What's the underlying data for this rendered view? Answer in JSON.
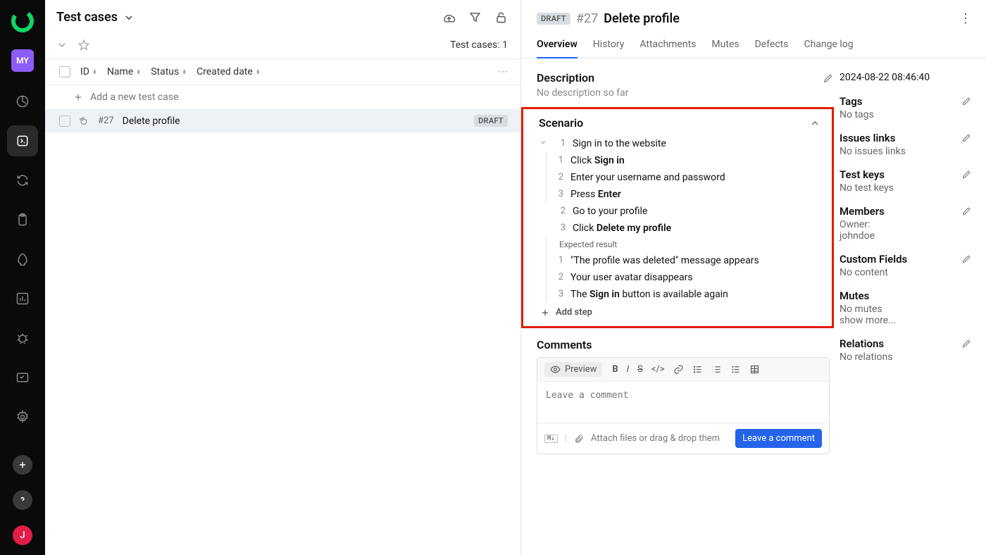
{
  "sidebar": {
    "project_badge": "MY",
    "user_initial": "J"
  },
  "left": {
    "title": "Test cases",
    "count_label": "Test cases: 1",
    "columns": {
      "id": "ID",
      "name": "Name",
      "status": "Status",
      "created": "Created date"
    },
    "add_row": "Add a new test case",
    "row": {
      "id": "#27",
      "name": "Delete profile",
      "badge": "DRAFT"
    }
  },
  "detail": {
    "badge": "DRAFT",
    "id": "#27",
    "title": "Delete profile",
    "tabs": {
      "overview": "Overview",
      "history": "History",
      "attachments": "Attachments",
      "mutes": "Mutes",
      "defects": "Defects",
      "changelog": "Change log"
    },
    "description_title": "Description",
    "description_value": "No description so far",
    "scenario_title": "Scenario",
    "steps": {
      "s1": {
        "num": "1",
        "text": "Sign in to the website",
        "sub": {
          "a": {
            "num": "1",
            "pre": "Click ",
            "bold": "Sign in"
          },
          "b": {
            "num": "2",
            "text": "Enter your username and password"
          },
          "c": {
            "num": "3",
            "pre": "Press ",
            "bold": "Enter"
          }
        }
      },
      "s2": {
        "num": "2",
        "text": "Go to your profile"
      },
      "s3": {
        "num": "3",
        "pre": "Click ",
        "bold": "Delete my profile",
        "expected_label": "Expected result",
        "expected": {
          "a": {
            "num": "1",
            "text": "\"The profile was deleted\" message appears"
          },
          "b": {
            "num": "2",
            "text": "Your user avatar disappears"
          },
          "c": {
            "num": "3",
            "pre": "The ",
            "bold": "Sign in",
            "post": " button is available again"
          }
        }
      }
    },
    "add_step": "Add step",
    "comments_title": "Comments",
    "preview": "Preview",
    "comment_placeholder": "Leave a comment",
    "attach_hint": "Attach files or drag & drop them",
    "leave_btn": "Leave a comment"
  },
  "side": {
    "timestamp": "2024-08-22 08:46:40",
    "tags": {
      "title": "Tags",
      "value": "No tags"
    },
    "issues": {
      "title": "Issues links",
      "value": "No issues links"
    },
    "keys": {
      "title": "Test keys",
      "value": "No test keys"
    },
    "members": {
      "title": "Members",
      "owner_label": "Owner:",
      "owner_value": "johndoe"
    },
    "custom": {
      "title": "Custom Fields",
      "value": "No content"
    },
    "mutes": {
      "title": "Mutes",
      "value": "No mutes",
      "more": "show more..."
    },
    "relations": {
      "title": "Relations",
      "value": "No relations"
    }
  }
}
